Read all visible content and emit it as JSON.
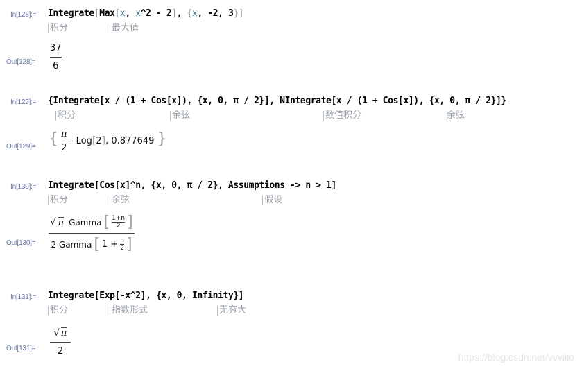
{
  "cells": [
    {
      "in_label": "In[128]:=",
      "out_label": "Out[128]=",
      "input": {
        "t1": "Integrate",
        "t2": "[",
        "t3": "Max",
        "t4": "[",
        "t5": "x",
        "t6": ", ",
        "t7": "x",
        "t8": "^2 - 2",
        "t9": "]",
        "t10": ", ",
        "t11": "{",
        "t12": "x",
        "t13": ", -2, 3",
        "t14": "}",
        "t15": "]"
      },
      "hints": [
        "积分",
        "最大值"
      ],
      "output": {
        "numerator": "37",
        "denominator": "6"
      }
    },
    {
      "in_label": "In[129]:=",
      "out_label": "Out[129]=",
      "input_text": "{Integrate[x / (1 + Cos[x]), {x, 0, π / 2}], NIntegrate[x / (1 + Cos[x]), {x, 0, π / 2}]}",
      "hints": [
        "积分",
        "余弦",
        "数值积分",
        "余弦"
      ],
      "output": {
        "open": "{",
        "frac_num": "π",
        "frac_den": "2",
        "rest": " - Log",
        "log_arg": "2",
        "value": "0.877649",
        "close": "}"
      }
    },
    {
      "in_label": "In[130]:=",
      "out_label": "Out[130]=",
      "input_text": "Integrate[Cos[x]^n, {x, 0, π / 2}, Assumptions -> n > 1]",
      "hints": [
        "积分",
        "余弦",
        "假设"
      ],
      "output": {
        "num_sqrt": "√",
        "num_pi": "π",
        "num_gamma": "Gamma",
        "num_arg_num": "1+n",
        "num_arg_den": "2",
        "den_coeff": "2 Gamma",
        "den_arg_1": "1 +",
        "den_arg_num": "n",
        "den_arg_den": "2"
      }
    },
    {
      "in_label": "In[131]:=",
      "out_label": "Out[131]=",
      "input_text": "Integrate[Exp[-x^2], {x, 0, Infinity}]",
      "hints": [
        "积分",
        "指数形式",
        "无穷大"
      ],
      "output": {
        "num_sqrt": "√",
        "num_pi": "π",
        "denominator": "2"
      }
    }
  ],
  "watermark": "https://blog.csdn.net/vvviiio"
}
